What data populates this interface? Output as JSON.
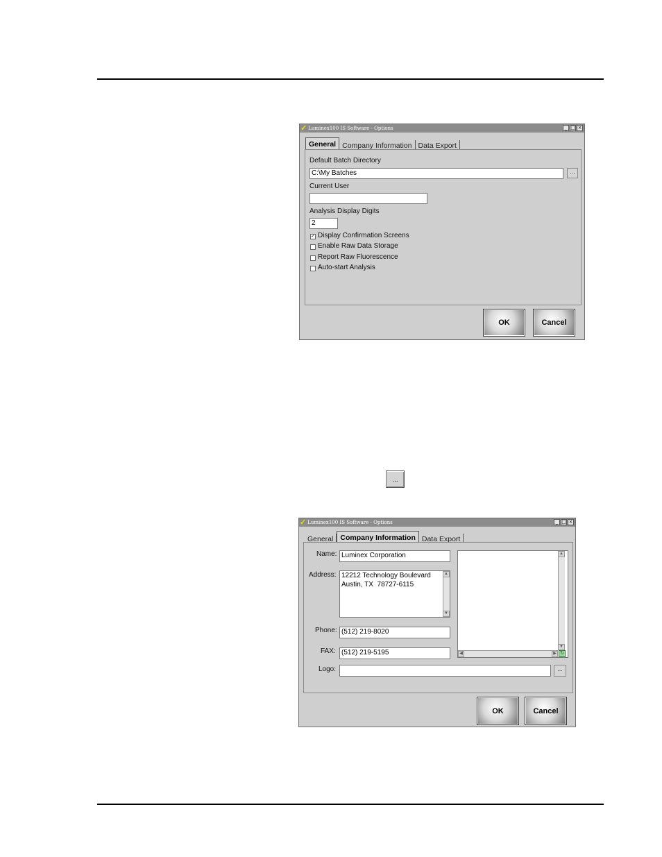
{
  "window1": {
    "title": "Luminex100 IS Software - Options",
    "tabs": [
      "General",
      "Company Information",
      "Data Export"
    ],
    "active_tab": "General",
    "batch_dir_label": "Default Batch Directory",
    "batch_dir_value": "C:\\My Batches",
    "current_user_label": "Current User",
    "current_user_value": "",
    "digits_label": "Analysis Display Digits",
    "digits_value": "2",
    "checkboxes": [
      {
        "label": "Display Confirmation Screens",
        "checked": true
      },
      {
        "label": "Enable Raw Data Storage",
        "checked": false
      },
      {
        "label": "Report Raw Fluorescence",
        "checked": false
      },
      {
        "label": "Auto-start Analysis",
        "checked": false
      }
    ],
    "ok_label": "OK",
    "cancel_label": "Cancel",
    "browse_label": "..."
  },
  "ellipsis_button_label": "...",
  "window2": {
    "title": "Luminex100 IS Software - Options",
    "tabs": [
      "General",
      "Company Information",
      "Data Export"
    ],
    "active_tab": "Company Information",
    "name_label": "Name:",
    "name_value": "Luminex Corporation",
    "address_label": "Address:",
    "address_value": "12212 Technology Boulevard\nAustin, TX  78727-6115",
    "phone_label": "Phone:",
    "phone_value": "(512) 219-8020",
    "fax_label": "FAX:",
    "fax_value": "(512) 219-5195",
    "logo_label": "Logo:",
    "logo_value": "",
    "browse_label": "...",
    "ok_label": "OK",
    "cancel_label": "Cancel"
  }
}
